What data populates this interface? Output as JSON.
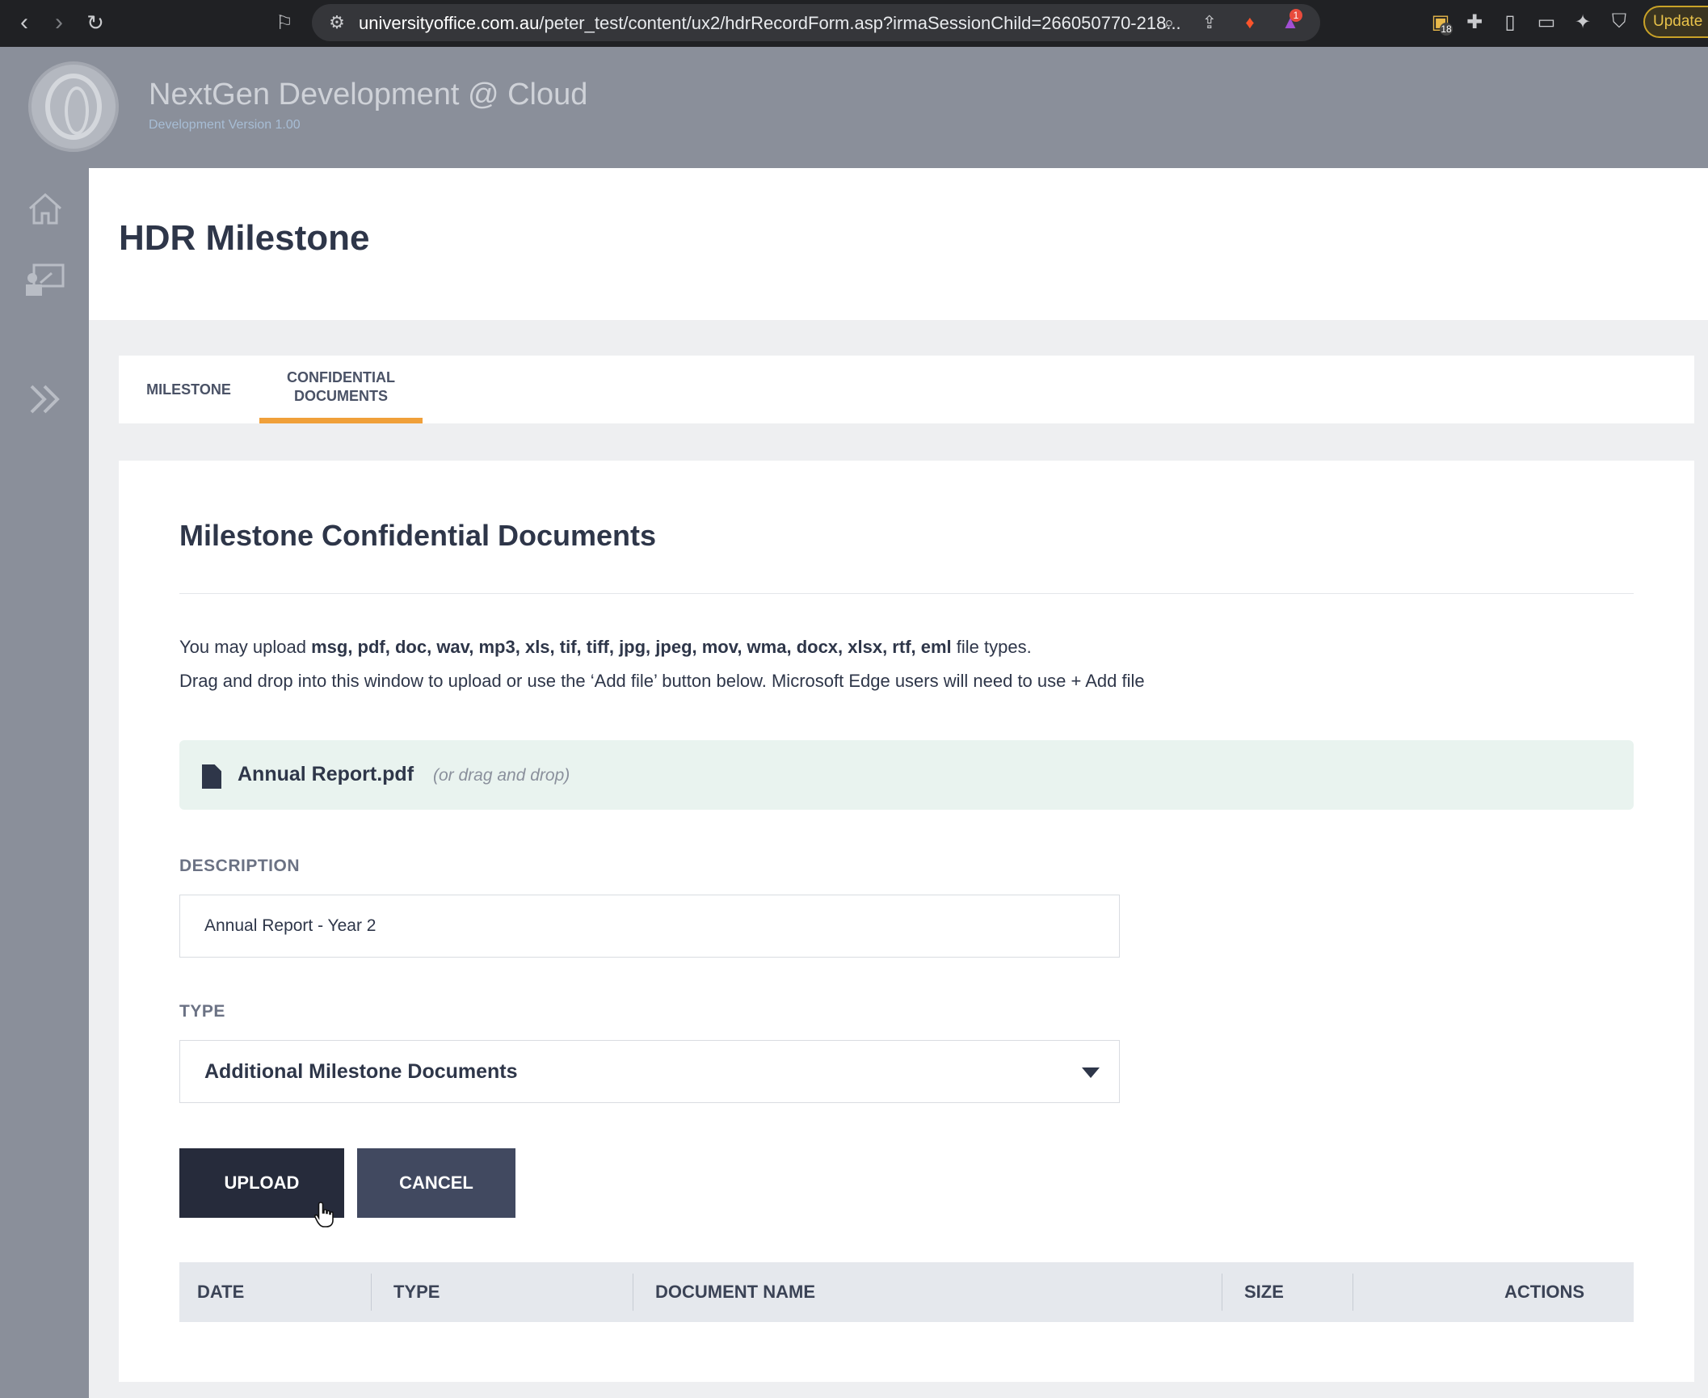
{
  "browser": {
    "url_host": "universityoffice.com.au",
    "url_path": "/peter_test/content/ux2/hdrRecordForm.asp?irmaSessionChild=266050770-218...",
    "extensions_badge": "18",
    "brave_badge": "1",
    "update_label": "Update"
  },
  "app": {
    "title": "NextGen Development @ Cloud",
    "version": "Development Version 1.00"
  },
  "sidebar": {
    "icons": [
      "home-icon",
      "presentation-icon",
      "expand-icon"
    ]
  },
  "page": {
    "title": "HDR Milestone"
  },
  "tabs": [
    {
      "label": "MILESTONE",
      "active": false
    },
    {
      "label_line1": "CONFIDENTIAL",
      "label_line2": "DOCUMENTS",
      "active": true
    }
  ],
  "section": {
    "title": "Milestone Confidential Documents",
    "info_prefix": "You may upload ",
    "info_types": "msg, pdf, doc, wav, mp3, xls, tif, tiff, jpg, jpeg, mov, wma, docx, xlsx, rtf, eml",
    "info_suffix": " file types.",
    "drag_info": "Drag and drop into this window to upload or use the ‘Add file’ button below. Microsoft Edge users will need to use + Add file"
  },
  "file": {
    "name": "Annual Report.pdf",
    "hint": "(or drag and drop)"
  },
  "form": {
    "description_label": "DESCRIPTION",
    "description_value": "Annual Report - Year 2",
    "type_label": "TYPE",
    "type_value": "Additional Milestone Documents"
  },
  "buttons": {
    "upload": "UPLOAD",
    "cancel": "CANCEL"
  },
  "table": {
    "columns": [
      "DATE",
      "TYPE",
      "DOCUMENT NAME",
      "SIZE",
      "ACTIONS"
    ]
  },
  "colors": {
    "accent_tab": "#f0a03a",
    "header_bg": "#8a8f9a",
    "upload_btn": "#262b3b",
    "cancel_btn": "#414960"
  }
}
